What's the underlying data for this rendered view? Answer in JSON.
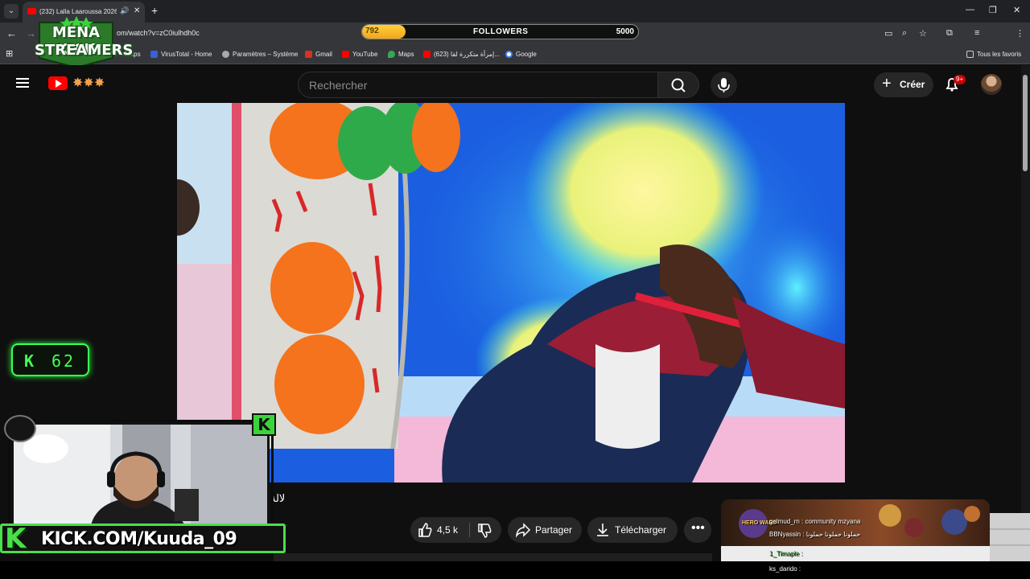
{
  "browser": {
    "tab_title": "(232) Lalla Laaroussa 2026",
    "url": "om/watch?v=zC0iulhdh0c",
    "bookmarks": [
      "Maps",
      "VirusTotal - Home",
      "Paramètres – Système",
      "Gmail",
      "YouTube",
      "Maps",
      "(623) إمرأة متكررة لقا...",
      "Google"
    ],
    "all_bookmarks_label": "Tous les favoris"
  },
  "stream_overlay": {
    "logo_line1": "MENA KICK",
    "logo_line2": "STREAMERS",
    "followers_current": "792",
    "followers_label": "FOLLOWERS",
    "followers_goal": "5000",
    "followers_progress": 0.158,
    "kick_counter_letter": "K",
    "kick_counter_value": "62",
    "kick_badge_letter": "K",
    "kick_banner_letter": "K",
    "kick_banner_text": "KICK.COM/Kuuda_09",
    "accent_green": "#49e04a",
    "followers_color": "#f3a51c"
  },
  "youtube": {
    "search_placeholder": "Rechercher",
    "create_label": "Créer",
    "notification_count": "9+",
    "video_title_fragment": "لالة",
    "actions": {
      "like_count": "4,5 k",
      "share_label": "Partager",
      "download_label": "Télécharger"
    }
  },
  "chat": {
    "game_logo": "HERO WARS",
    "line1": "gelmud_rn : community mzyana",
    "line2": "BBNyassin : حملونا حملونا حملونا",
    "line3": "1_Timaple : ",
    "bottom_user": "ks_darido :"
  }
}
